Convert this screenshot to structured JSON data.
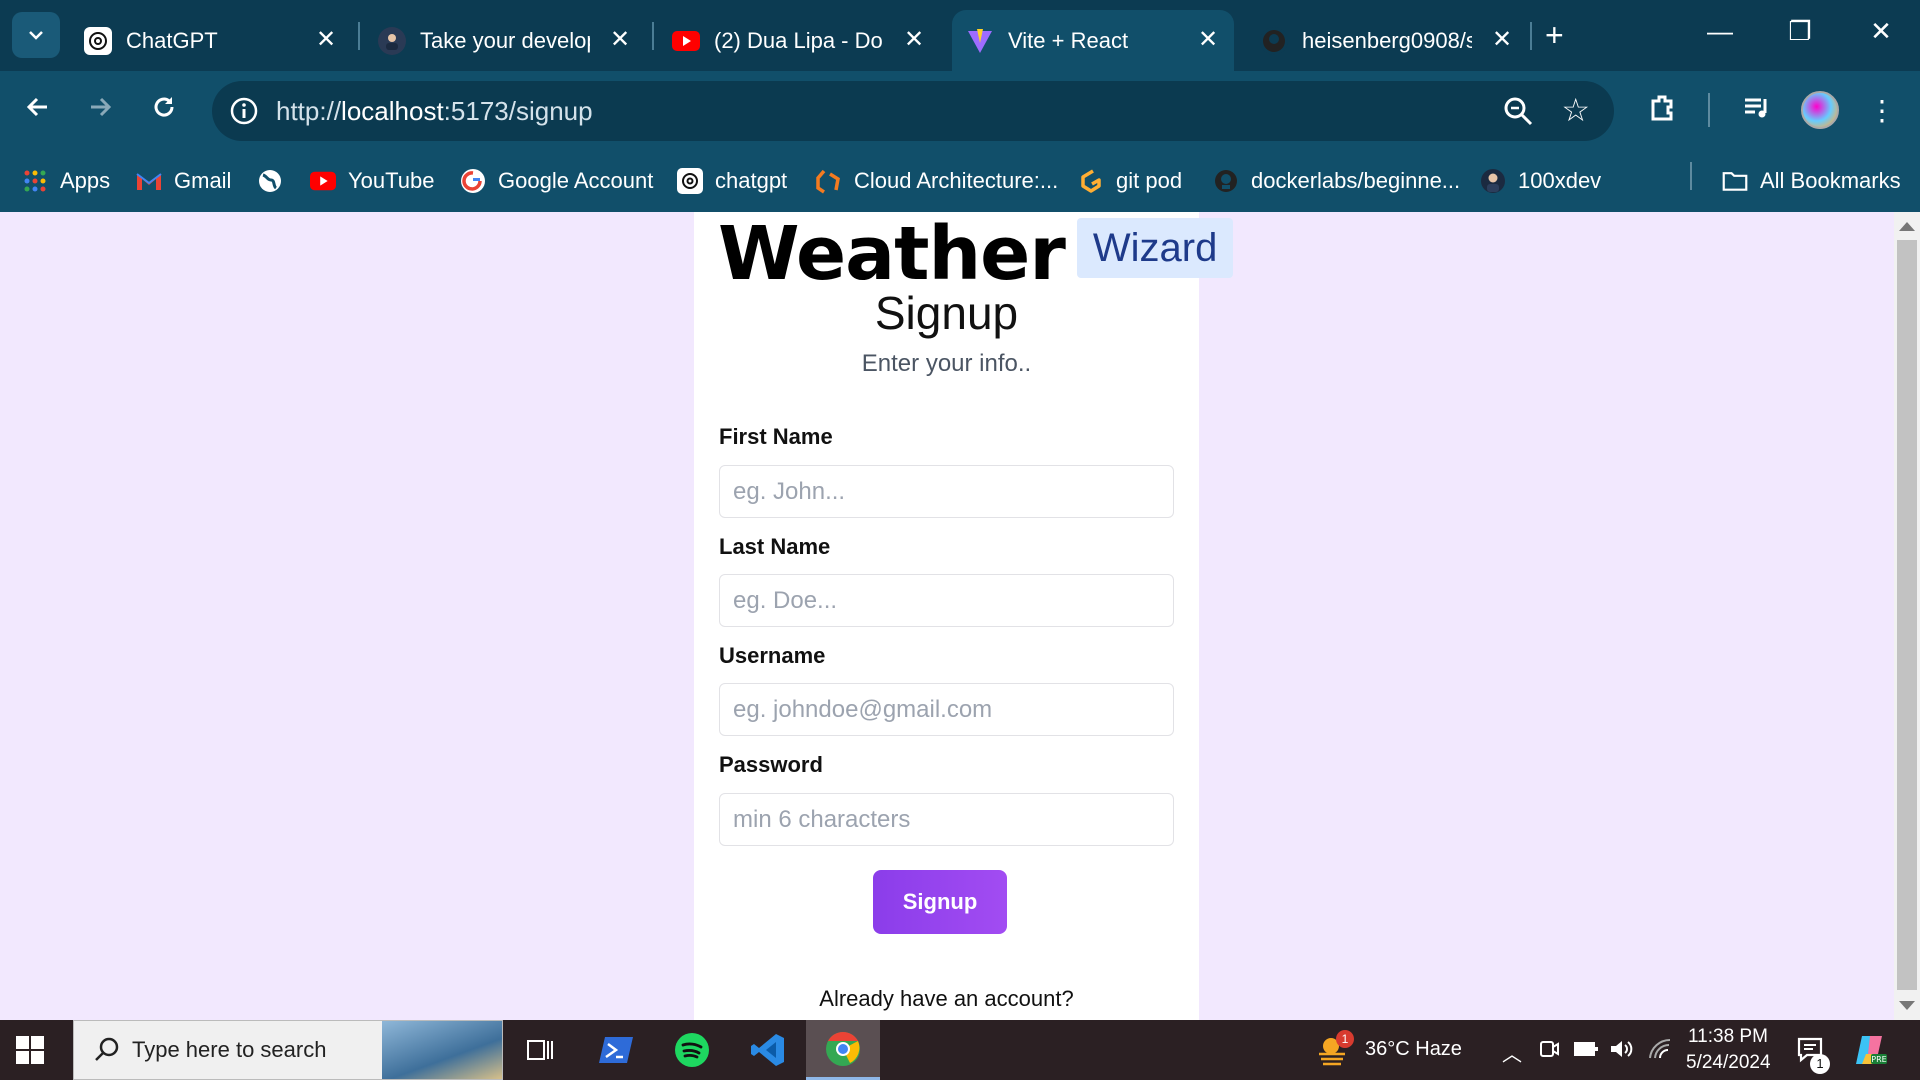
{
  "browser": {
    "tabs": [
      {
        "title": "ChatGPT",
        "icon": "chatgpt-icon",
        "active": false
      },
      {
        "title": "Take your develop",
        "icon": "person-avatar-icon",
        "active": false
      },
      {
        "title": "(2) Dua Lipa - Don",
        "icon": "youtube-icon",
        "active": false
      },
      {
        "title": "Vite + React",
        "icon": "vite-icon",
        "active": true
      },
      {
        "title": "heisenberg0908/s",
        "icon": "github-icon",
        "active": false
      }
    ],
    "url_prefix": "http://",
    "url_host": "localhost",
    "url_rest": ":5173/signup",
    "bookmarks": [
      {
        "label": "Apps",
        "icon": "apps-grid-icon"
      },
      {
        "label": "Gmail",
        "icon": "gmail-icon"
      },
      {
        "label": "",
        "icon": "globe-icon"
      },
      {
        "label": "YouTube",
        "icon": "youtube-icon"
      },
      {
        "label": "Google Account",
        "icon": "google-icon"
      },
      {
        "label": "chatgpt",
        "icon": "chatgpt-icon"
      },
      {
        "label": "Cloud Architecture:...",
        "icon": "cloud-arch-icon"
      },
      {
        "label": "git pod",
        "icon": "gitpod-icon"
      },
      {
        "label": "dockerlabs/beginne...",
        "icon": "github-icon"
      },
      {
        "label": "100xdev",
        "icon": "person-avatar-icon"
      }
    ],
    "all_bookmarks": "All Bookmarks"
  },
  "page": {
    "brand_weather": "Weather",
    "brand_wizard": "Wizard",
    "heading": "Signup",
    "subheading": "Enter your info..",
    "fields": [
      {
        "label": "First Name",
        "placeholder": "eg. John..."
      },
      {
        "label": "Last Name",
        "placeholder": "eg. Doe..."
      },
      {
        "label": "Username",
        "placeholder": "eg. johndoe@gmail.com"
      },
      {
        "label": "Password",
        "placeholder": "min 6 characters"
      }
    ],
    "submit_label": "Signup",
    "already_text": "Already have an account?"
  },
  "taskbar": {
    "search_placeholder": "Type here to search",
    "weather": "36°C  Haze",
    "weather_badge": "1",
    "time": "11:38 PM",
    "date": "5/24/2024",
    "notification_count": "1"
  },
  "colors": {
    "page_background": "#f2e8fe",
    "button_gradient_start": "#8b3dea",
    "button_gradient_end": "#a24cf2",
    "wizard_badge_bg": "#dbe9fe",
    "wizard_badge_text": "#1e3a8a"
  }
}
